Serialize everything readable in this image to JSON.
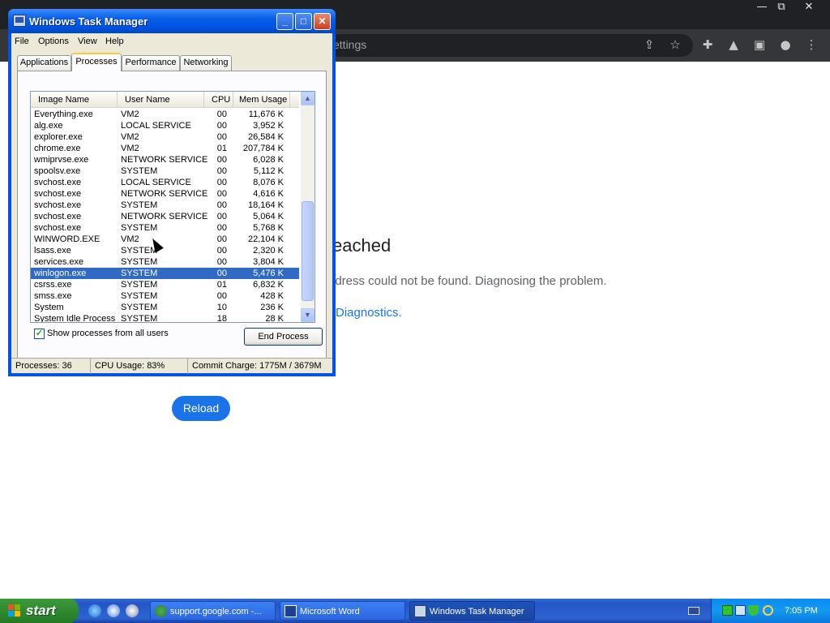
{
  "browser": {
    "window_controls": [
      "—",
      "⧉",
      "✕"
    ],
    "omnibox_text": "ettings",
    "error_title": "eached",
    "error_desc": "ldress could not be found. Diagnosing the problem.",
    "error_link": "Diagnostics.",
    "reload_label": "Reload",
    "toolbar_icons": [
      "share-icon",
      "star-icon",
      "extensions-icon",
      "flask-icon",
      "sidepanel-icon",
      "profile-icon",
      "menu-icon"
    ]
  },
  "task_manager": {
    "title": "Windows Task Manager",
    "caption_buttons": {
      "minimize": "_",
      "maximize": "□",
      "close": "✕"
    },
    "menu": [
      "File",
      "Options",
      "View",
      "Help"
    ],
    "tabs": [
      "Applications",
      "Processes",
      "Performance",
      "Networking"
    ],
    "active_tab": "Processes",
    "columns": [
      "Image Name",
      "User Name",
      "CPU",
      "Mem Usage"
    ],
    "processes": [
      {
        "name": "Everything.exe",
        "user": "VM2",
        "cpu": "00",
        "mem": "11,676 K"
      },
      {
        "name": "alg.exe",
        "user": "LOCAL SERVICE",
        "cpu": "00",
        "mem": "3,952 K"
      },
      {
        "name": "explorer.exe",
        "user": "VM2",
        "cpu": "00",
        "mem": "26,584 K"
      },
      {
        "name": "chrome.exe",
        "user": "VM2",
        "cpu": "01",
        "mem": "207,784 K"
      },
      {
        "name": "wmiprvse.exe",
        "user": "NETWORK SERVICE",
        "cpu": "00",
        "mem": "6,028 K"
      },
      {
        "name": "spoolsv.exe",
        "user": "SYSTEM",
        "cpu": "00",
        "mem": "5,112 K"
      },
      {
        "name": "svchost.exe",
        "user": "LOCAL SERVICE",
        "cpu": "00",
        "mem": "8,076 K"
      },
      {
        "name": "svchost.exe",
        "user": "NETWORK SERVICE",
        "cpu": "00",
        "mem": "4,616 K"
      },
      {
        "name": "svchost.exe",
        "user": "SYSTEM",
        "cpu": "00",
        "mem": "18,164 K"
      },
      {
        "name": "svchost.exe",
        "user": "NETWORK SERVICE",
        "cpu": "00",
        "mem": "5,064 K"
      },
      {
        "name": "svchost.exe",
        "user": "SYSTEM",
        "cpu": "00",
        "mem": "5,768 K"
      },
      {
        "name": "WINWORD.EXE",
        "user": "VM2",
        "cpu": "00",
        "mem": "22,104 K"
      },
      {
        "name": "lsass.exe",
        "user": "SYSTEM",
        "cpu": "00",
        "mem": "2,320 K"
      },
      {
        "name": "services.exe",
        "user": "SYSTEM",
        "cpu": "00",
        "mem": "3,804 K"
      },
      {
        "name": "winlogon.exe",
        "user": "SYSTEM",
        "cpu": "00",
        "mem": "5,476 K",
        "selected": true
      },
      {
        "name": "csrss.exe",
        "user": "SYSTEM",
        "cpu": "01",
        "mem": "6,832 K"
      },
      {
        "name": "smss.exe",
        "user": "SYSTEM",
        "cpu": "00",
        "mem": "428 K"
      },
      {
        "name": "System",
        "user": "SYSTEM",
        "cpu": "10",
        "mem": "236 K"
      },
      {
        "name": "System Idle Process",
        "user": "SYSTEM",
        "cpu": "18",
        "mem": "28 K"
      }
    ],
    "show_all_users_label": "Show processes from all users",
    "show_all_users_checked": true,
    "end_process_label": "End Process",
    "status": {
      "processes": "Processes: 36",
      "cpu_usage": "CPU Usage: 83%",
      "commit_charge": "Commit Charge: 1775M / 3679M"
    }
  },
  "taskbar": {
    "start_label": "start",
    "quick_launch": [
      "ie-icon",
      "media-icon",
      "firefox-icon"
    ],
    "tasks": [
      {
        "label": "support.google.com -...",
        "icon": "chrome-icon"
      },
      {
        "label": "Microsoft Word",
        "icon": "word-icon"
      },
      {
        "label": "Windows Task Manager",
        "icon": "taskmgr-icon",
        "active": true
      }
    ],
    "tray_icons": [
      "keyboard-icon",
      "network-icon",
      "monitor-icon",
      "shield-icon",
      "search-icon"
    ],
    "clock": "7:05 PM"
  }
}
